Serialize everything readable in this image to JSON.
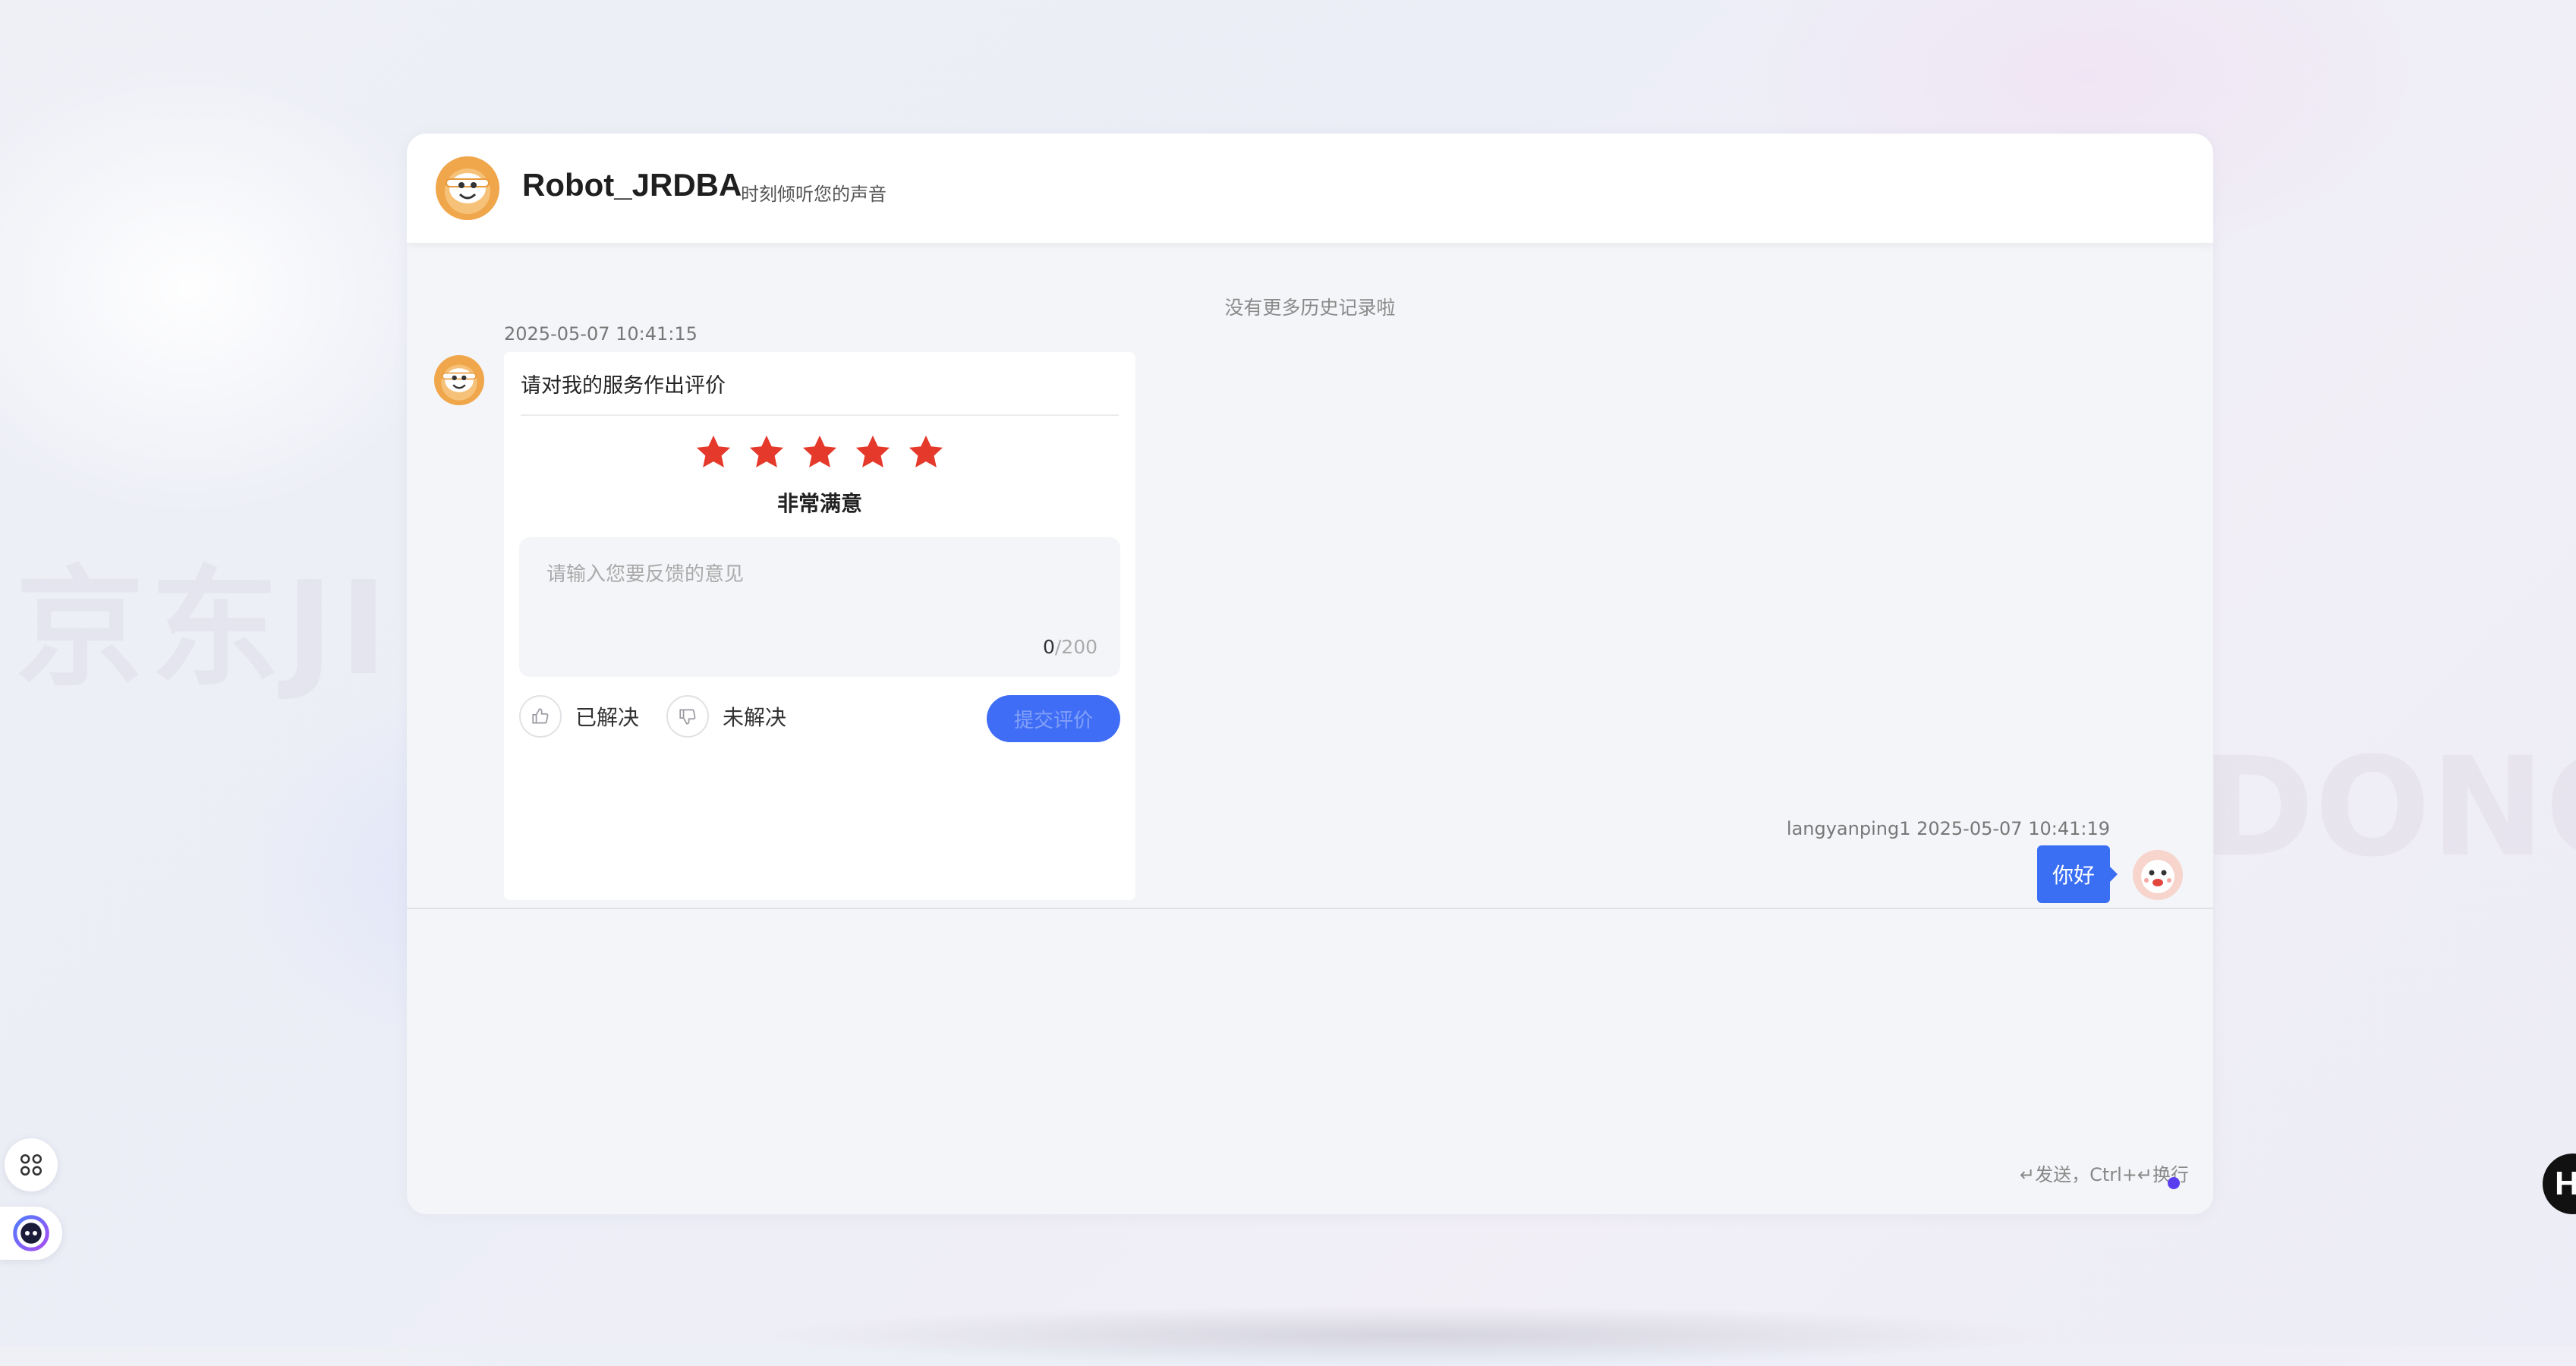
{
  "background": {
    "watermark_left": "京东JI",
    "watermark_right": "DONG"
  },
  "header": {
    "name": "Robot_JRDBA",
    "subtitle": "时刻倾听您的声音"
  },
  "chat": {
    "no_more_history": "没有更多历史记录啦",
    "bot_message": {
      "timestamp": "2025-05-07 10:41:15",
      "title": "请对我的服务作出评价",
      "rating": {
        "value": 5,
        "max": 5
      },
      "rating_label": "非常满意",
      "feedback_placeholder": "请输入您要反馈的意见",
      "char_count": "0",
      "char_max": "/200",
      "resolved_label": "已解决",
      "unresolved_label": "未解决",
      "submit_label": "提交评价"
    },
    "user_message": {
      "meta": "langyanping1 2025-05-07 10:41:19",
      "text": "你好"
    }
  },
  "input": {
    "hint": "↵发送，Ctrl+↵换行"
  },
  "edge_button_label": "H",
  "colors": {
    "accent": "#3a6ef3",
    "star": "#e53a2b",
    "page_bg": "#eef0f6",
    "chat_bg": "#f4f5f8"
  },
  "icons": [
    "robot-avatar-icon",
    "star-icon",
    "thumbs-up-icon",
    "thumbs-down-icon",
    "user-avatar-icon",
    "shortcut-icon",
    "assistant-icon"
  ]
}
